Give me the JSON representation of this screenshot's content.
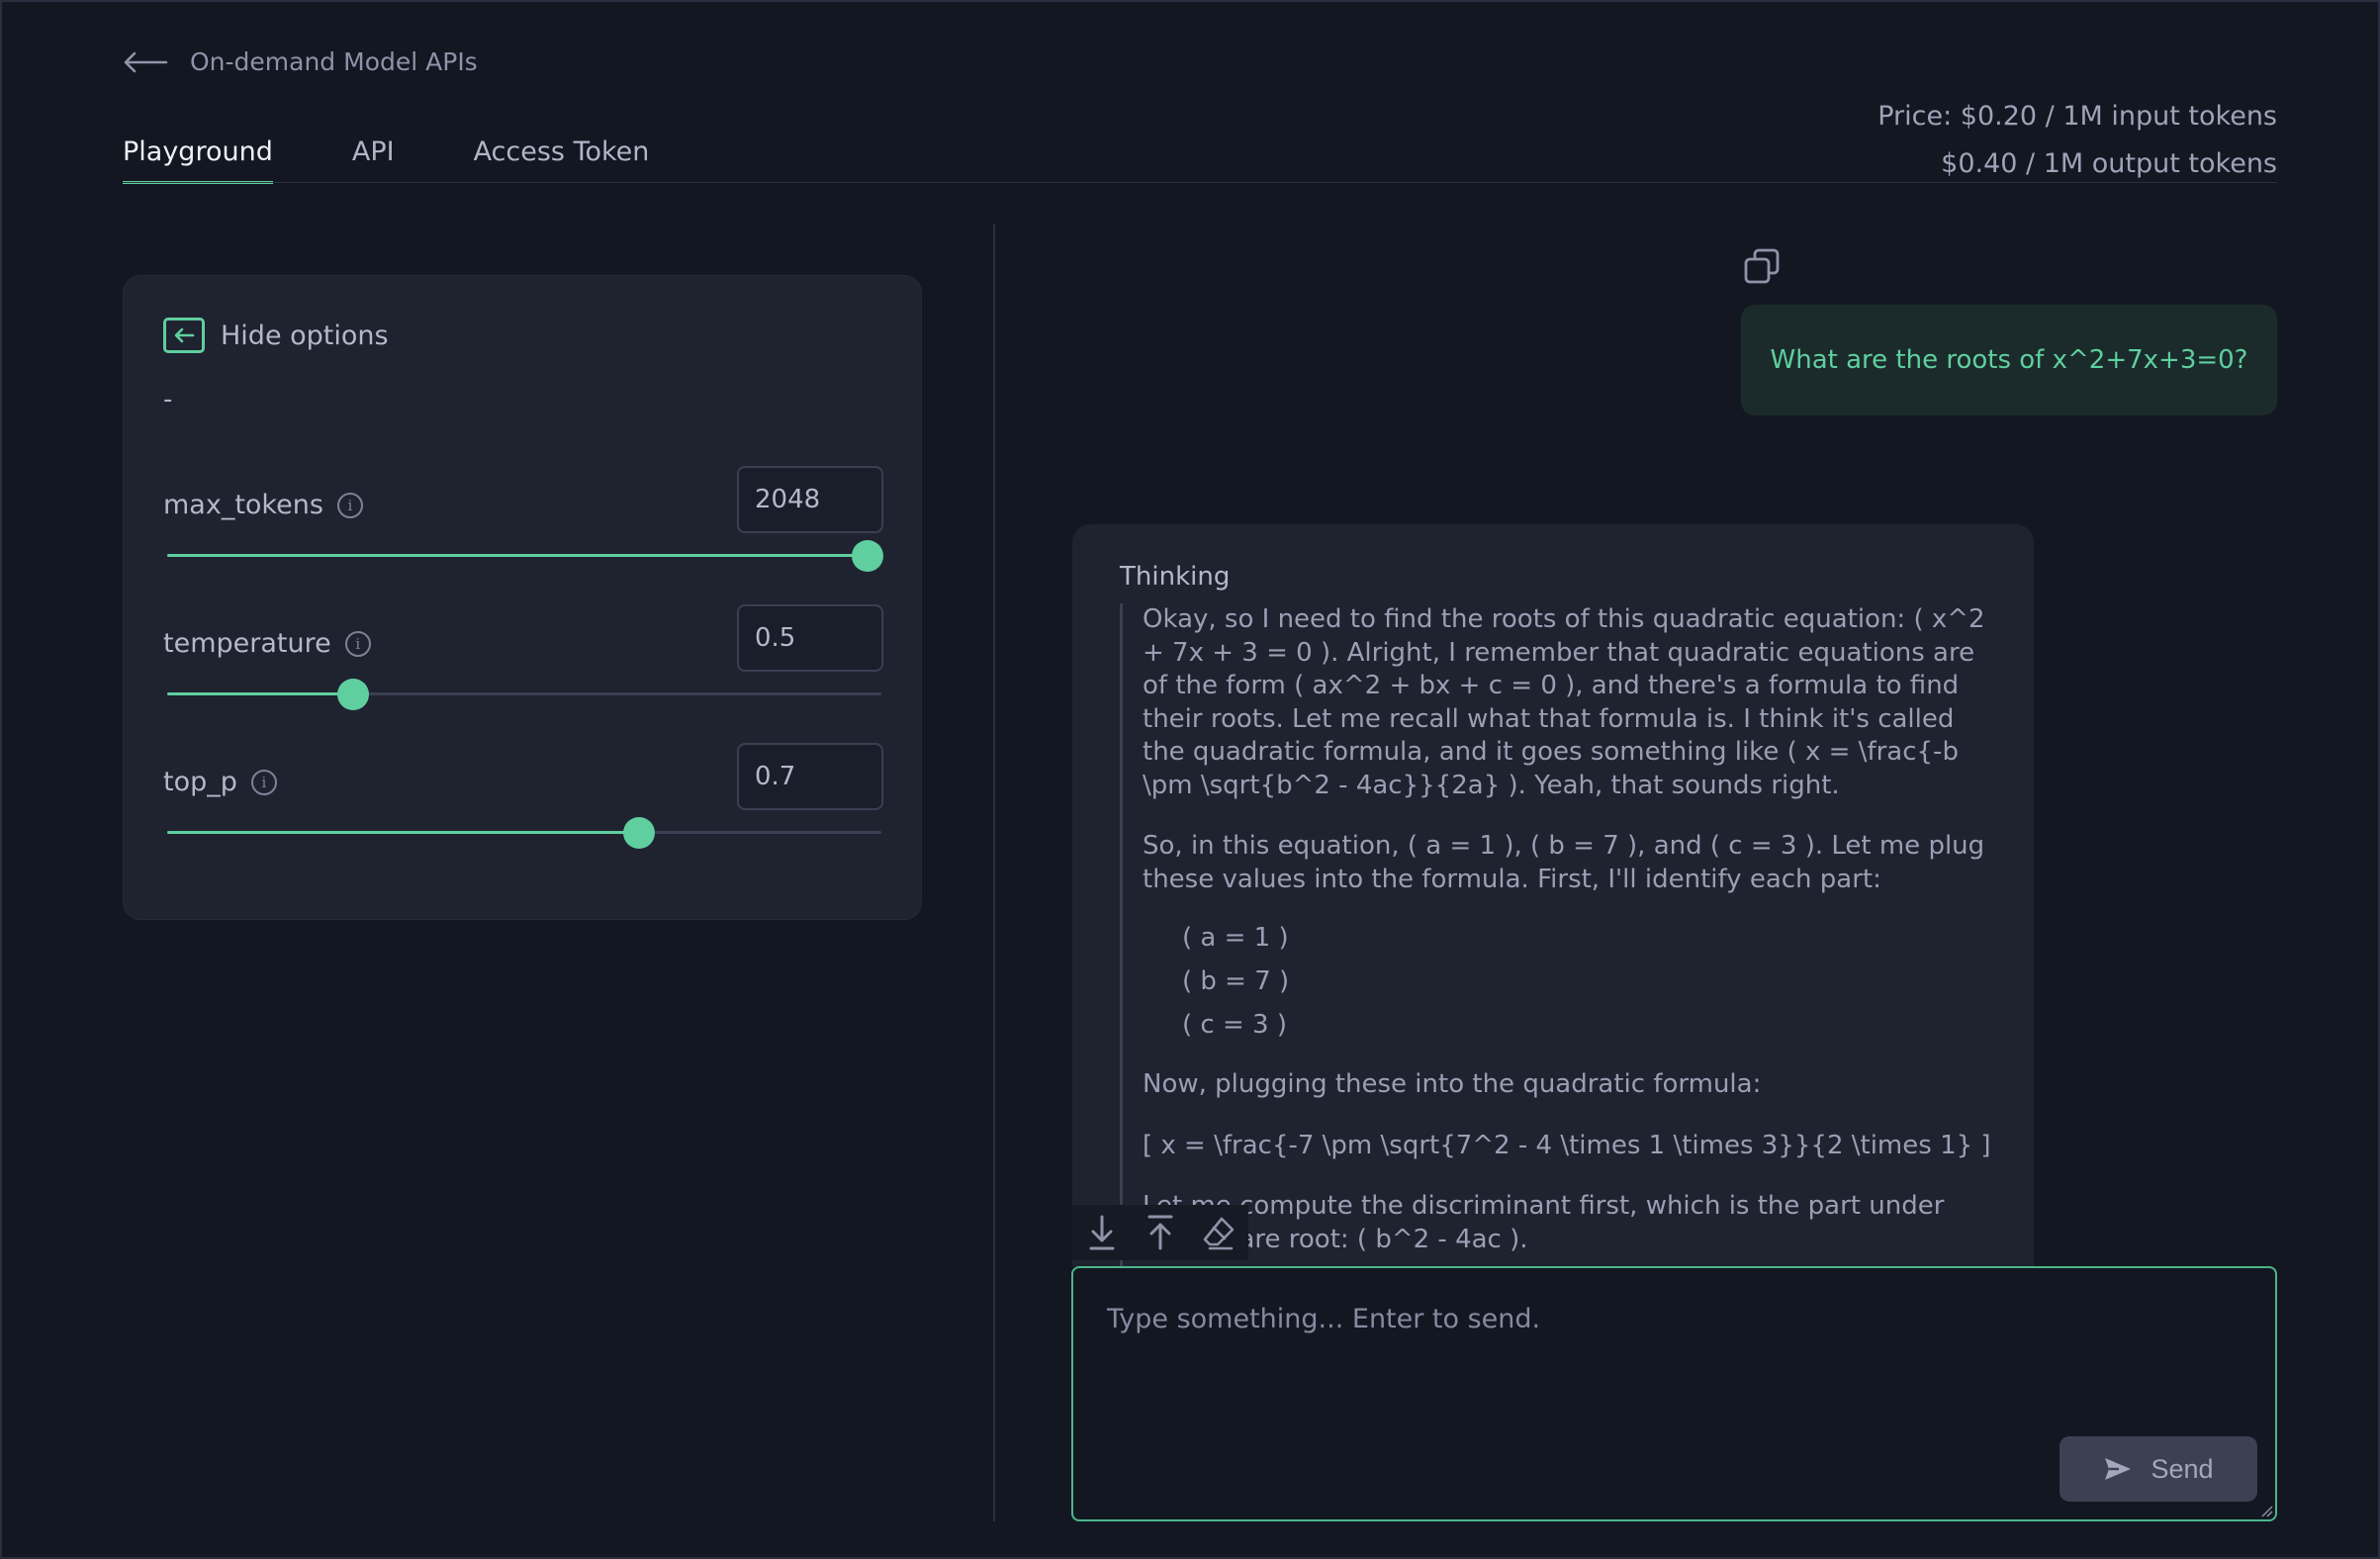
{
  "header": {
    "back_label": "On-demand Model APIs",
    "tabs": [
      {
        "label": "Playground",
        "active": true
      },
      {
        "label": "API",
        "active": false
      },
      {
        "label": "Access Token",
        "active": false
      }
    ],
    "price_input": "Price: $0.20 / 1M input tokens",
    "price_output": "$0.40 / 1M output tokens"
  },
  "options": {
    "hide_label": "Hide options",
    "dash": "-",
    "params": [
      {
        "name": "max_tokens",
        "value": "2048",
        "fill_fraction": 0.98
      },
      {
        "name": "temperature",
        "value": "0.5",
        "fill_fraction": 0.26
      },
      {
        "name": "top_p",
        "value": "0.7",
        "fill_fraction": 0.66
      }
    ]
  },
  "chat": {
    "user_message": "What are the roots of x^2+7x+3=0?",
    "reply_title": "Thinking",
    "thinking": {
      "p1": "Okay, so I need to find the roots of this quadratic equation: ( x^2 + 7x + 3 = 0 ). Alright, I remember that quadratic equations are of the form ( ax^2 + bx + c = 0 ), and there's a formula to find their roots. Let me recall what that formula is. I think it's called the quadratic formula, and it goes something like ( x = \\frac{-b \\pm \\sqrt{b^2 - 4ac}}{2a} ). Yeah, that sounds right.",
      "p2": "So, in this equation, ( a = 1 ), ( b = 7 ), and ( c = 3 ). Let me plug these values into the formula. First, I'll identify each part:",
      "list": [
        "( a = 1 )",
        "( b = 7 )",
        "( c = 3 )"
      ],
      "p3": "Now, plugging these into the quadratic formula:",
      "p4": "[ x = \\frac{-7 \\pm \\sqrt{7^2 - 4 \\times 1 \\times 3}}{2 \\times 1} ]",
      "p5": "Let me compute the discriminant first, which is the part under the square root: ( b^2 - 4ac )."
    },
    "input_placeholder": "Type something... Enter to send.",
    "send_label": "Send"
  },
  "colors": {
    "accent": "#5fcf9f",
    "background": "#131722",
    "panel": "#1f2330"
  }
}
